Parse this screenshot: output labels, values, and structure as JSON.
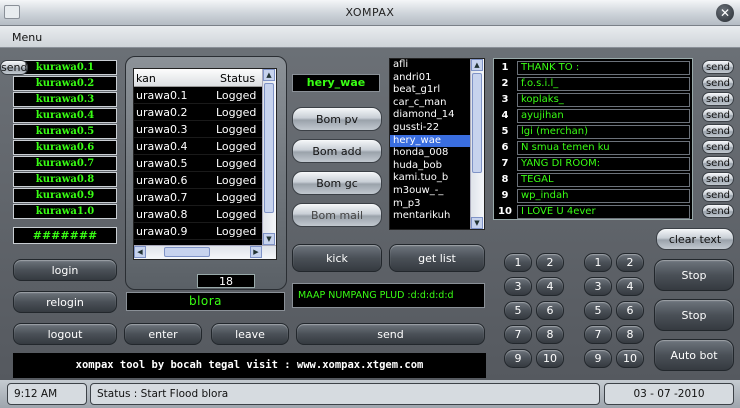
{
  "window": {
    "title": "XOMPAX",
    "close_glyph": "✕"
  },
  "menu": {
    "label": "Menu"
  },
  "left_list": [
    "kurawa0.1",
    "kurawa0.2",
    "kurawa0.3",
    "kurawa0.4",
    "kurawa0.5",
    "kurawa0.6",
    "kurawa0.7",
    "kurawa0.8",
    "kurawa0.9",
    "kurawa1.0"
  ],
  "hash_field": "#######",
  "left_buttons": {
    "login": "login",
    "relogin": "relogin",
    "logout": "logout",
    "enter": "enter",
    "leave": "leave",
    "send": "send"
  },
  "listview": {
    "col1": "kan",
    "col2": "Status",
    "rows": [
      {
        "name": "urawa0.1",
        "status": "Logged"
      },
      {
        "name": "urawa0.2",
        "status": "Logged"
      },
      {
        "name": "urawa0.3",
        "status": "Logged"
      },
      {
        "name": "urawa0.4",
        "status": "Logged"
      },
      {
        "name": "urawa0.5",
        "status": "Logged"
      },
      {
        "name": "urawa0.6",
        "status": "Logged"
      },
      {
        "name": "urawa0.7",
        "status": "Logged"
      },
      {
        "name": "urawa0.8",
        "status": "Logged"
      },
      {
        "name": "urawa0.9",
        "status": "Logged"
      }
    ],
    "count": "18"
  },
  "room_field": "blora",
  "target_nick": "hery_wae",
  "bom_buttons": {
    "pv": "Bom pv",
    "add": "Bom add",
    "gc": "Bom gc",
    "mail": "Bom mail"
  },
  "user_list": {
    "items": [
      "afli",
      "andri01",
      "beat_g1rl",
      "car_c_man",
      "diamond_14",
      "gussti-22",
      "hery_wae",
      "honda_008",
      "huda_bob",
      "kami.tuo_b",
      "m3ouw_-_",
      "m_p3",
      "mentarikuh"
    ],
    "selected": "hery_wae"
  },
  "kick_label": "kick",
  "getlist_label": "get list",
  "message_field": "MAAP NUMPANG PLUD :d:d:d:d:d",
  "banner": "xompax tool by bocah tegal visit : www.xompax.xtgem.com",
  "messages": [
    {
      "num": "1",
      "text": "THANK TO :"
    },
    {
      "num": "2",
      "text": "f.o.s.i.l_"
    },
    {
      "num": "3",
      "text": "koplaks_"
    },
    {
      "num": "4",
      "text": "ayujihan"
    },
    {
      "num": "5",
      "text": "lgi (merchan)"
    },
    {
      "num": "6",
      "text": "N smua temen ku"
    },
    {
      "num": "7",
      "text": "YANG DI ROOM:"
    },
    {
      "num": "8",
      "text": "TEGAL"
    },
    {
      "num": "9",
      "text": "wp_indah"
    },
    {
      "num": "10",
      "text": "I LOVE U 4ever"
    }
  ],
  "send_label": "send",
  "numpad_keys": [
    "1",
    "2",
    "3",
    "4",
    "5",
    "6",
    "7",
    "8",
    "9",
    "10"
  ],
  "right_buttons": {
    "clear": "clear text",
    "stop1": "Stop",
    "stop2": "Stop",
    "autobot": "Auto bot"
  },
  "status_bar": {
    "time": "9:12 AM",
    "status": "Status : Start Flood blora",
    "date": "03 - 07 -2010"
  }
}
